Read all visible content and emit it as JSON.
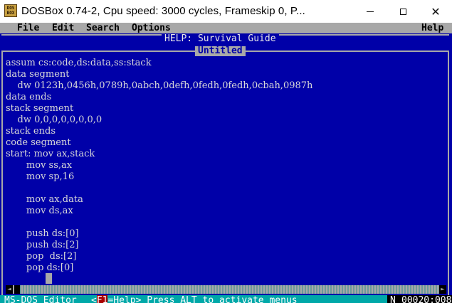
{
  "window": {
    "icon_text": "DOS BOX",
    "title": "DOSBox 0.74-2, Cpu speed:      3000 cycles, Frameskip  0, P...",
    "minimize_icon": "minimize-icon",
    "maximize_icon": "maximize-icon",
    "close_symbol": "✕"
  },
  "menu": {
    "file": "File",
    "edit": "Edit",
    "search": "Search",
    "options": "Options",
    "help": "Help"
  },
  "editor": {
    "help_title": "HELP: Survival Guide",
    "file_title": "Untitled",
    "lines": [
      "assum cs:code,ds:data,ss:stack",
      "data segment",
      "    dw 0123h,0456h,0789h,0abch,0defh,0fedh,0fedh,0cbah,0987h",
      "data ends",
      "stack segment",
      "    dw 0,0,0,0,0,0,0,0",
      "stack ends",
      "code segment",
      "start: mov ax,stack",
      "       mov ss,ax",
      "       mov sp,16",
      "",
      "       mov ax,data",
      "       mov ds,ax",
      "",
      "       push ds:[0]",
      "       push ds:[2]",
      "       pop  ds:[2]",
      "       pop ds:[0]"
    ]
  },
  "scrollbar": {
    "left_arrow": "◄",
    "right_arrow": "►"
  },
  "status": {
    "app_name": "MS-DOS Editor",
    "hint_pre": "<",
    "hint_f1": "F1",
    "hint_post": "=Help> Press ALT to activate menus",
    "mode_flag": "N",
    "position": "00020:008"
  },
  "colors": {
    "dos_blue": "#0000a8",
    "menu_gray": "#a8a8a8",
    "status_cyan": "#00a8a8",
    "code_text": "#d8d8d8"
  }
}
